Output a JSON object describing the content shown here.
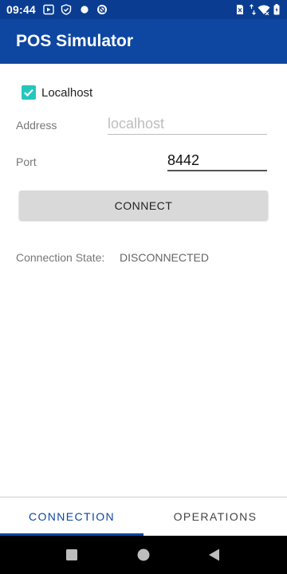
{
  "status_bar": {
    "time": "09:44",
    "icons": [
      "media-icon",
      "shield-icon",
      "dot-icon",
      "sync-icon",
      "sim-x-icon",
      "wifi-icon",
      "battery-icon"
    ]
  },
  "app_bar": {
    "title": "POS Simulator"
  },
  "form": {
    "localhost": {
      "label": "Localhost",
      "checked": true
    },
    "address": {
      "label": "Address",
      "value": "",
      "placeholder": "localhost"
    },
    "port": {
      "label": "Port",
      "value": "8442"
    },
    "connect_label": "CONNECT"
  },
  "connection_state": {
    "label": "Connection State:",
    "value": "DISCONNECTED"
  },
  "tabs": [
    {
      "label": "CONNECTION",
      "selected": true
    },
    {
      "label": "OPERATIONS",
      "selected": false
    }
  ],
  "colors": {
    "primary": "#0d47a1",
    "status_bar": "#0a3d91",
    "checkbox_accent": "#26c6be",
    "button_bg": "#d9d9d9"
  },
  "nav_bar": {
    "buttons": [
      "recents-icon",
      "home-icon",
      "back-icon"
    ]
  }
}
